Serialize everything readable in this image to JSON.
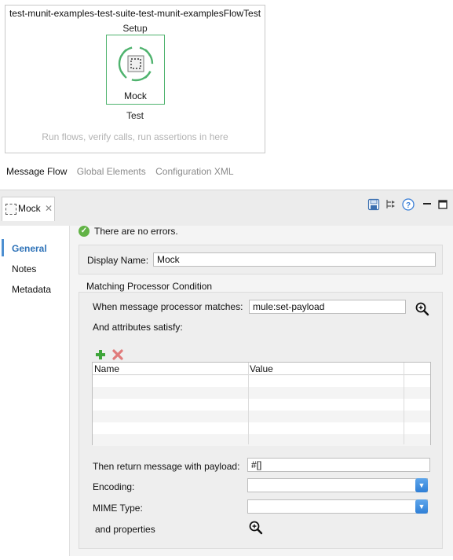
{
  "canvas": {
    "flow_title": "test-munit-examples-test-suite-test-munit-examplesFlowTest",
    "setup_label": "Setup",
    "mock_label": "Mock",
    "test_label": "Test",
    "hint": "Run flows, verify calls, run assertions in here"
  },
  "editor_tabs": [
    "Message Flow",
    "Global Elements",
    "Configuration XML"
  ],
  "properties": {
    "tab_label": "Mock",
    "tab_close": "✕",
    "nav": [
      "General",
      "Notes",
      "Metadata"
    ],
    "status": "There are no errors.",
    "display_name_label": "Display Name:",
    "display_name_value": "Mock",
    "section_title": "Matching Processor Condition",
    "matches_label": "When message processor matches:",
    "matches_value": "mule:set-payload",
    "attributes_label": "And attributes satisfy:",
    "table_headers": [
      "Name",
      "Value"
    ],
    "return_label": "Then return message with payload:",
    "return_value": "#[]",
    "encoding_label": "Encoding:",
    "encoding_value": "",
    "mime_label": "MIME Type:",
    "mime_value": "",
    "and_properties_label": "and properties"
  },
  "icons": {
    "save": "save-icon",
    "tree": "tree-icon",
    "help": "help-icon",
    "minimize": "minimize-icon",
    "maximize": "maximize-icon"
  },
  "colors": {
    "accent": "#2f73b8",
    "mock_border": "#4fb36e",
    "ok": "#62b346"
  }
}
